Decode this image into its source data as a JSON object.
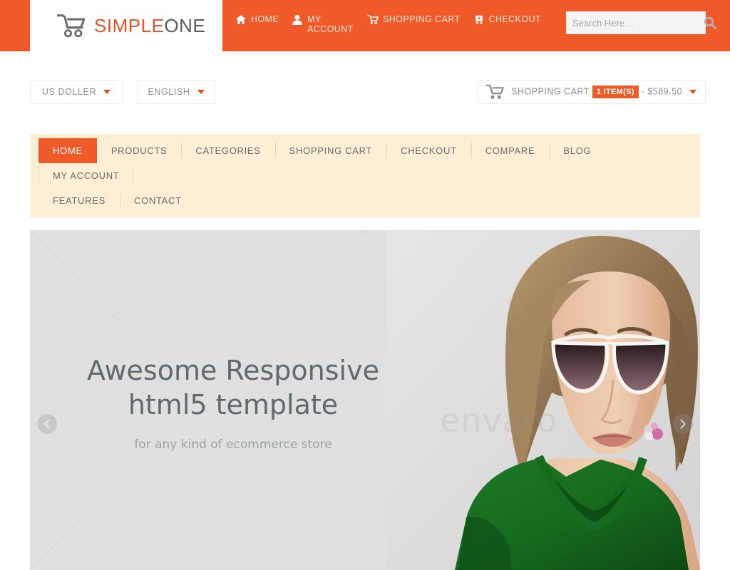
{
  "header": {
    "logo": {
      "icon": "shopping-cart-icon",
      "text_a": "SIMPLE",
      "text_b": "ONE"
    },
    "nav": [
      {
        "label": "HOME",
        "icon": "home-icon"
      },
      {
        "label": "MY ACCOUNT",
        "icon": "user-icon"
      },
      {
        "label": "SHOPPING CART",
        "icon": "cart-icon"
      },
      {
        "label": "CHECKOUT",
        "icon": "checkout-cart-icon"
      }
    ],
    "search": {
      "placeholder": "Search Here…",
      "value": "",
      "icon": "search-icon"
    }
  },
  "utility": {
    "currency": {
      "label": "US DOLLER",
      "icon": "chevron-down-icon"
    },
    "language": {
      "label": "ENGLISH",
      "icon": "chevron-down-icon"
    },
    "cart": {
      "icon": "cart-icon",
      "label": "SHOPPING CART",
      "badge": "1 ITEM(S)",
      "price": "- $589.50",
      "caret": "chevron-down-icon"
    }
  },
  "mainnav": {
    "row1": [
      {
        "label": "HOME",
        "active": true
      },
      {
        "label": "PRODUCTS",
        "active": false
      },
      {
        "label": "CATEGORIES",
        "active": false
      },
      {
        "label": "SHOPPING CART",
        "active": false
      },
      {
        "label": "CHECKOUT",
        "active": false
      },
      {
        "label": "COMPARE",
        "active": false
      },
      {
        "label": "BLOG",
        "active": false
      },
      {
        "label": "MY ACCOUNT",
        "active": false
      }
    ],
    "row2": [
      {
        "label": "FEATURES",
        "active": false
      },
      {
        "label": "CONTACT",
        "active": false
      }
    ]
  },
  "hero": {
    "title_line1": "Awesome Responsive",
    "title_line2": "html5 template",
    "subtitle": "for any kind of ecommerce store",
    "prev_icon": "chevron-left-icon",
    "next_icon": "chevron-right-icon",
    "watermark": "envato"
  },
  "colors": {
    "brand_orange": "#ef5a28",
    "nav_cream": "#fcefd6",
    "hero_bg": "#e0e0e0",
    "logo_gray": "#5a5a5a",
    "sweater_green": "#18661f"
  }
}
